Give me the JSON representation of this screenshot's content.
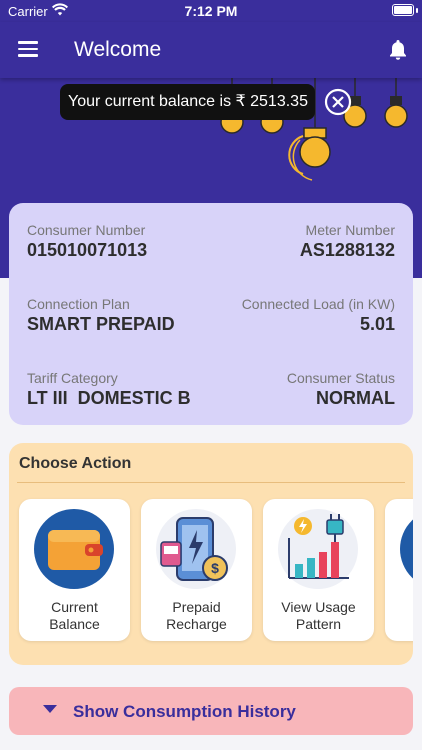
{
  "status_bar": {
    "carrier": "Carrier",
    "time": "7:12 PM"
  },
  "header": {
    "title": "Welcome",
    "menu_icon": "hamburger-menu-icon",
    "notification_icon": "bell-icon"
  },
  "balance": {
    "message": "Your current balance is ₹ 2513.35"
  },
  "consumer": {
    "consumer_number": {
      "label": "Consumer Number",
      "value": "015010071013"
    },
    "meter_number": {
      "label": "Meter Number",
      "value": "AS1288132"
    },
    "connection_plan": {
      "label": "Connection Plan",
      "value": "SMART PREPAID"
    },
    "connected_load": {
      "label": "Connected Load (in KW)",
      "value": "5.01"
    },
    "tariff_category": {
      "label": "Tariff Category",
      "value": "LT III  DOMESTIC B"
    },
    "consumer_status": {
      "label": "Consumer Status",
      "value": "NORMAL"
    }
  },
  "actions": {
    "title": "Choose Action",
    "items": [
      {
        "line1": "Current",
        "line2": "Balance",
        "icon": "wallet-icon"
      },
      {
        "line1": "Prepaid",
        "line2": "Recharge",
        "icon": "recharge-icon"
      },
      {
        "line1": "View Usage",
        "line2": "Pattern",
        "icon": "usage-chart-icon"
      }
    ]
  },
  "history": {
    "label": "Show Consumption History"
  },
  "colors": {
    "primary": "#3a2e9c",
    "card": "#d8d3f9",
    "action_panel": "#fde0b1",
    "history_bar": "#f8b6ba",
    "bulb": "#f5b82e"
  }
}
